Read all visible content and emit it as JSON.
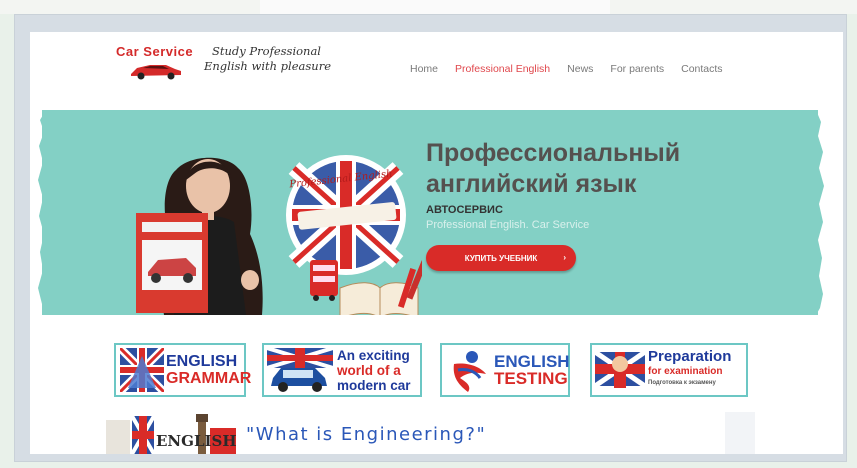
{
  "logo": {
    "brand": "Car Service",
    "tagline_line1": "Study Professional",
    "tagline_line2": "English with pleasure"
  },
  "nav": {
    "items": [
      "Home",
      "Professional English",
      "News",
      "For parents",
      "Contacts"
    ],
    "active_index": 1
  },
  "hero": {
    "title_line1": "Профессиональный",
    "title_line2": "английский язык",
    "subtitle": "АВТОСЕРВИС",
    "subtitle2": "Professional English. Car Service",
    "bubble_text": "Professional English",
    "buy_button": "КУПИТЬ УЧЕБНИК",
    "buy_arrow": "›"
  },
  "banners": {
    "grammar": {
      "line1": "ENGLISH",
      "line2": "GRAMMAR"
    },
    "car": {
      "line1": "An exciting",
      "line2": "world of a",
      "line3": "modern car"
    },
    "testing": {
      "line1": "ENGLISH",
      "line2": "TESTING"
    },
    "exam": {
      "line1": "Preparation",
      "line2": "for examination",
      "line3": "Подготовка к экзамену"
    }
  },
  "bottom": {
    "section_title": "\"What is Engineering?\"",
    "strip_label": "ENGLISH"
  },
  "colors": {
    "accent_red": "#d92b28",
    "teal": "#83d0c5",
    "nav_active": "#e0474c",
    "brand_blue": "#1f3a9b"
  }
}
